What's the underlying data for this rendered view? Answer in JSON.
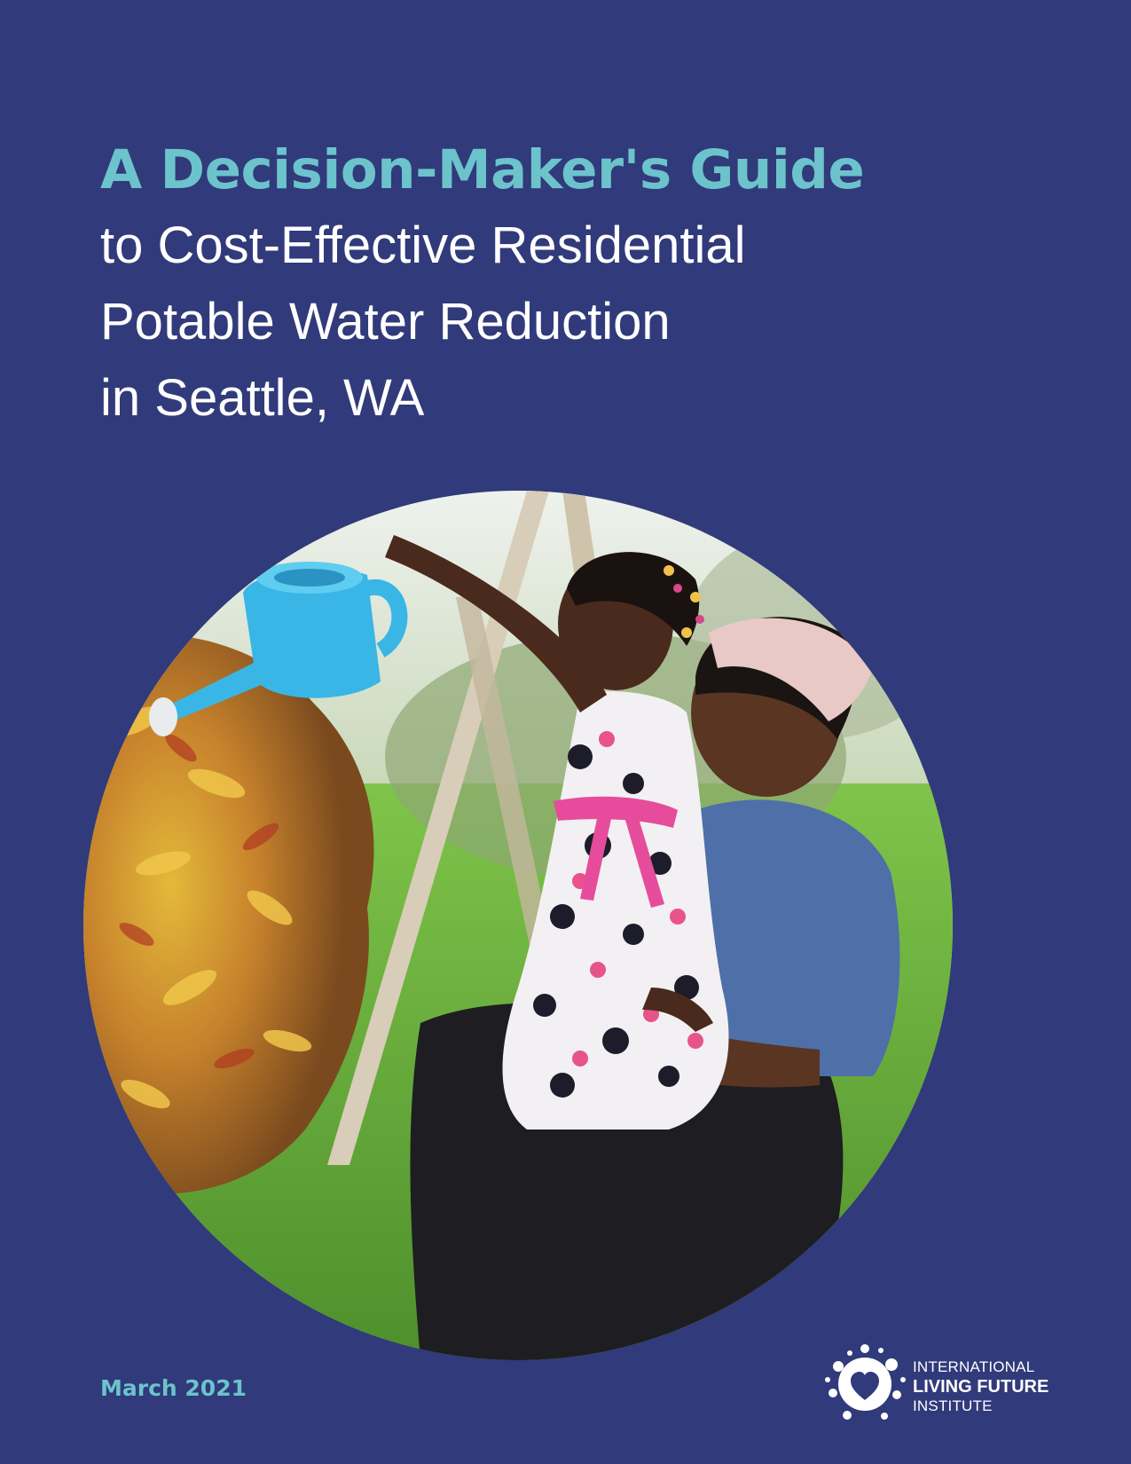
{
  "cover": {
    "title": "A Decision-Maker's Guide",
    "subtitle_lines": [
      "to Cost-Effective Residential",
      "Potable Water Reduction",
      "in Seattle, WA"
    ],
    "date": "March 2021"
  },
  "logo": {
    "line1": "INTERNATIONAL",
    "line2": "LIVING FUTURE",
    "line3": "INSTITUTE",
    "icon": "splash-heart-icon"
  },
  "colors": {
    "background": "#313a7a",
    "accent": "#6cc3cc",
    "text": "#ffffff"
  }
}
